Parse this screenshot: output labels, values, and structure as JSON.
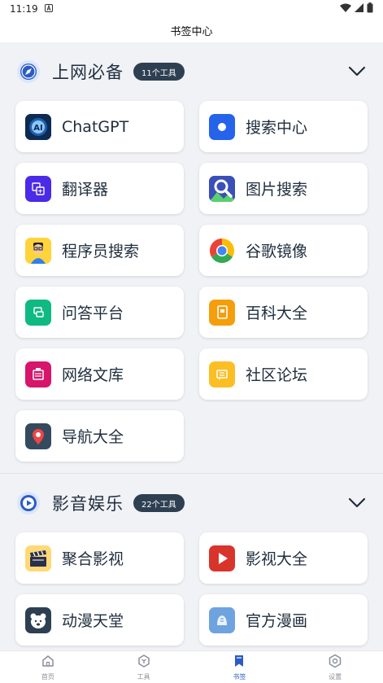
{
  "status_bar": {
    "time": "11:19"
  },
  "header": {
    "title": "书签中心"
  },
  "sections": [
    {
      "title": "上网必备",
      "badge": "11个工具",
      "items": [
        {
          "label": "ChatGPT",
          "icon": "ai-chip-icon"
        },
        {
          "label": "搜索中心",
          "icon": "search-dot-icon"
        },
        {
          "label": "翻译器",
          "icon": "translate-icon"
        },
        {
          "label": "图片搜索",
          "icon": "image-search-icon"
        },
        {
          "label": "程序员搜索",
          "icon": "programmer-avatar-icon"
        },
        {
          "label": "谷歌镜像",
          "icon": "chrome-icon"
        },
        {
          "label": "问答平台",
          "icon": "qa-icon"
        },
        {
          "label": "百科大全",
          "icon": "encyclopedia-icon"
        },
        {
          "label": "网络文库",
          "icon": "library-icon"
        },
        {
          "label": "社区论坛",
          "icon": "forum-icon"
        },
        {
          "label": "导航大全",
          "icon": "location-pin-icon"
        }
      ]
    },
    {
      "title": "影音娱乐",
      "badge": "22个工具",
      "items": [
        {
          "label": "聚合影视",
          "icon": "clapperboard-icon"
        },
        {
          "label": "影视大全",
          "icon": "play-icon"
        },
        {
          "label": "动漫天堂",
          "icon": "bear-icon"
        },
        {
          "label": "官方漫画",
          "icon": "comic-icon"
        }
      ]
    }
  ],
  "tabs": [
    {
      "label": "首页",
      "icon": "home-icon",
      "active": false
    },
    {
      "label": "工具",
      "icon": "toolbox-icon",
      "active": false
    },
    {
      "label": "书签",
      "icon": "bookmark-icon",
      "active": true
    },
    {
      "label": "设置",
      "icon": "settings-icon",
      "active": false
    }
  ],
  "colors": {
    "accent": "#2b5cc5",
    "badge_bg": "#2e3f52",
    "background": "#f1f2f6",
    "card": "#ffffff",
    "text": "#1f2d3d"
  }
}
